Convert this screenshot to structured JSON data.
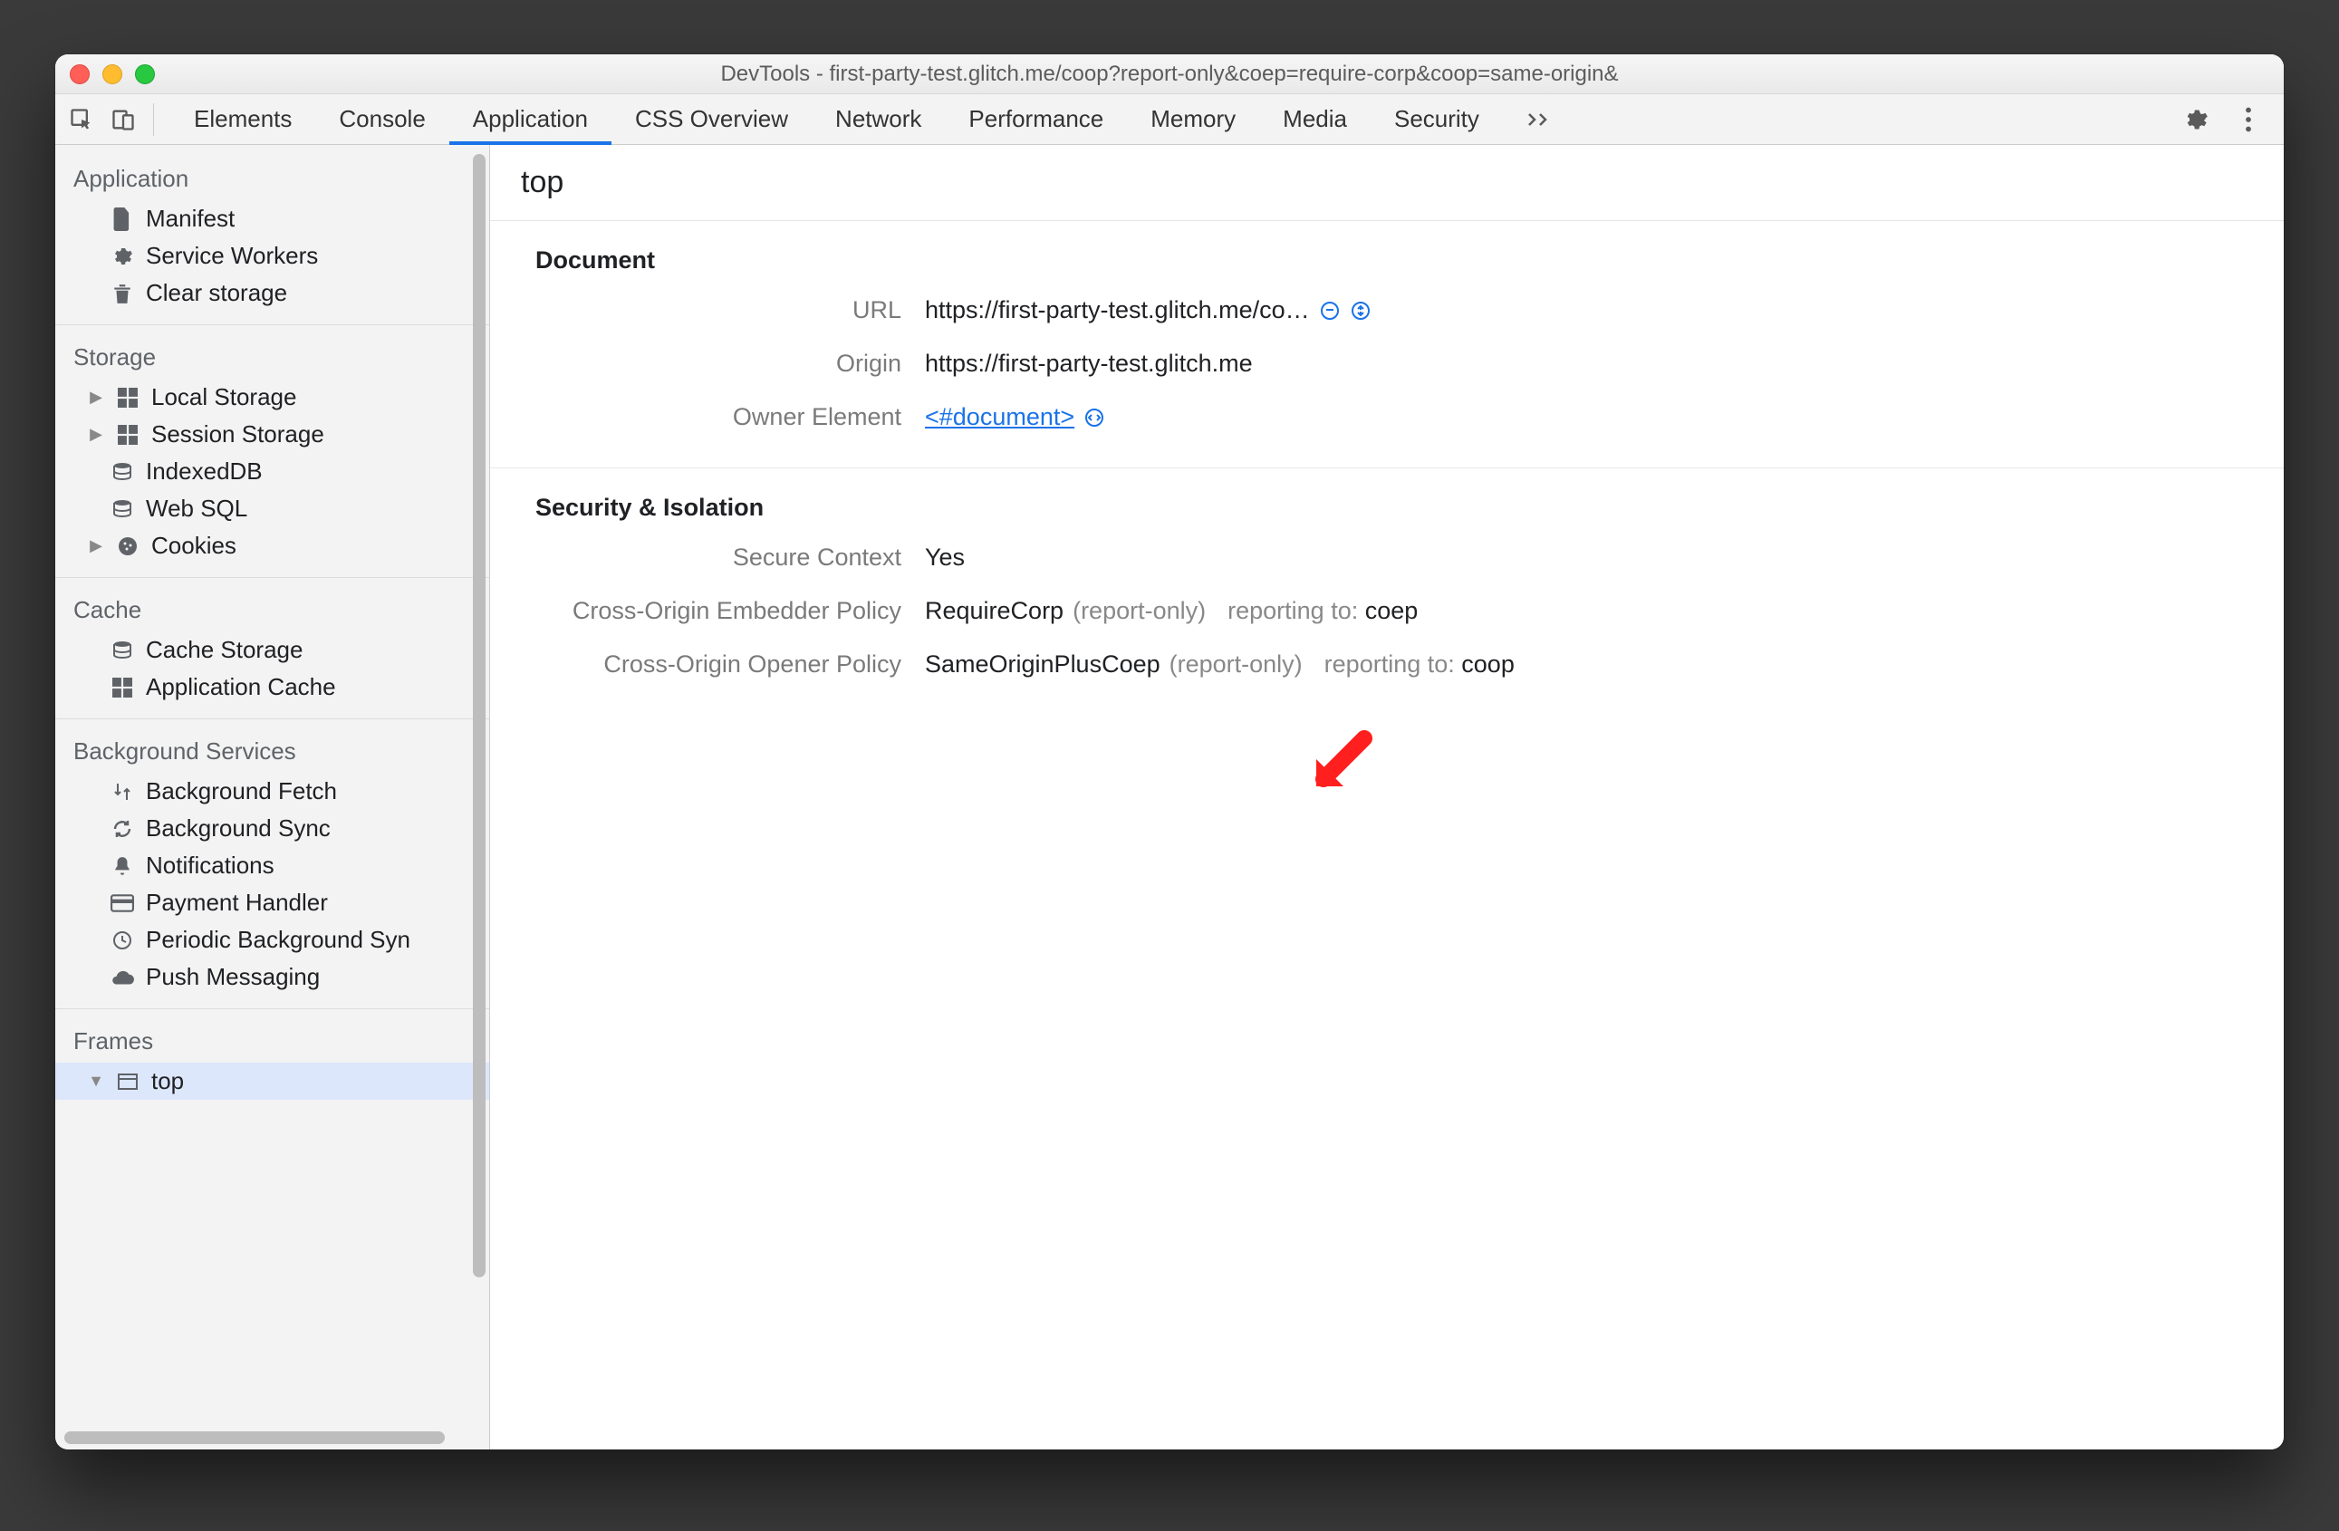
{
  "window": {
    "title": "DevTools - first-party-test.glitch.me/coop?report-only&coep=require-corp&coop=same-origin&"
  },
  "toolbar": {
    "tabs": [
      "Elements",
      "Console",
      "Application",
      "CSS Overview",
      "Network",
      "Performance",
      "Memory",
      "Media",
      "Security"
    ],
    "active_tab": "Application"
  },
  "sidebar": {
    "sections": [
      {
        "title": "Application",
        "items": [
          {
            "icon": "file",
            "label": "Manifest"
          },
          {
            "icon": "gear",
            "label": "Service Workers"
          },
          {
            "icon": "trash",
            "label": "Clear storage"
          }
        ]
      },
      {
        "title": "Storage",
        "items": [
          {
            "icon": "grid",
            "label": "Local Storage",
            "expandable": true
          },
          {
            "icon": "grid",
            "label": "Session Storage",
            "expandable": true
          },
          {
            "icon": "db",
            "label": "IndexedDB"
          },
          {
            "icon": "db",
            "label": "Web SQL"
          },
          {
            "icon": "cookie",
            "label": "Cookies",
            "expandable": true
          }
        ]
      },
      {
        "title": "Cache",
        "items": [
          {
            "icon": "db",
            "label": "Cache Storage"
          },
          {
            "icon": "grid",
            "label": "Application Cache"
          }
        ]
      },
      {
        "title": "Background Services",
        "items": [
          {
            "icon": "updown",
            "label": "Background Fetch"
          },
          {
            "icon": "sync",
            "label": "Background Sync"
          },
          {
            "icon": "bell",
            "label": "Notifications"
          },
          {
            "icon": "card",
            "label": "Payment Handler"
          },
          {
            "icon": "clock",
            "label": "Periodic Background Syn"
          },
          {
            "icon": "cloud",
            "label": "Push Messaging"
          }
        ]
      },
      {
        "title": "Frames",
        "items": [
          {
            "icon": "frame",
            "label": "top",
            "expandable": true,
            "open": true,
            "selected": true
          }
        ]
      }
    ]
  },
  "main": {
    "heading": "top",
    "document": {
      "section_title": "Document",
      "url_label": "URL",
      "url_value": "https://first-party-test.glitch.me/co…",
      "origin_label": "Origin",
      "origin_value": "https://first-party-test.glitch.me",
      "owner_label": "Owner Element",
      "owner_value": "<#document>"
    },
    "security": {
      "section_title": "Security & Isolation",
      "secure_context_label": "Secure Context",
      "secure_context_value": "Yes",
      "coep_label": "Cross-Origin Embedder Policy",
      "coep_value": "RequireCorp",
      "coep_mode": "(report-only)",
      "coep_reporting_prefix": "reporting to:",
      "coep_reporting_value": "coep",
      "coop_label": "Cross-Origin Opener Policy",
      "coop_value": "SameOriginPlusCoep",
      "coop_mode": "(report-only)",
      "coop_reporting_prefix": "reporting to:",
      "coop_reporting_value": "coop"
    }
  }
}
